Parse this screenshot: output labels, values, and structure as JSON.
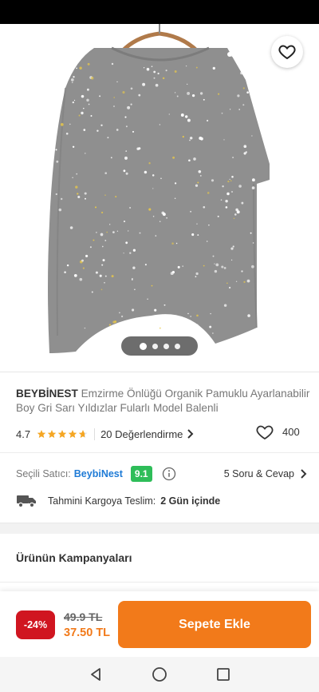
{
  "header": {
    "back_icon": "arrow-left-icon",
    "share_icon": "share-icon",
    "favorite_icon": "heart-icon"
  },
  "gallery": {
    "image_count": 4,
    "active_index": 0
  },
  "product": {
    "brand": "BEYBİNEST",
    "name": "Emzirme Önlüğü Organik Pamuklu Ayarlanabilir Boy Gri Sarı Yıldızlar Fularlı Model Balenli",
    "rating": "4.7",
    "rating_stars_value": 4.7,
    "reviews_label": "20 Değerlendirme",
    "favorites_count": "400"
  },
  "seller": {
    "label": "Seçili Satıcı:",
    "name": "BeybiNest",
    "score": "9.1",
    "qa_label": "5 Soru & Cevap"
  },
  "shipping": {
    "label": "Tahmini Kargoya Teslim:",
    "value": "2 Gün içinde"
  },
  "campaigns": {
    "title": "Ürünün Kampanyaları"
  },
  "purchase": {
    "discount": "-24%",
    "old_price": "49.9 TL",
    "new_price": "37.50 TL",
    "add_to_cart": "Sepete Ekle"
  },
  "colors": {
    "accent": "#f27a1a",
    "discount": "#d01520",
    "seller_link": "#1f7bd6",
    "score_badge": "#2ebd59",
    "star": "#f5a623"
  }
}
